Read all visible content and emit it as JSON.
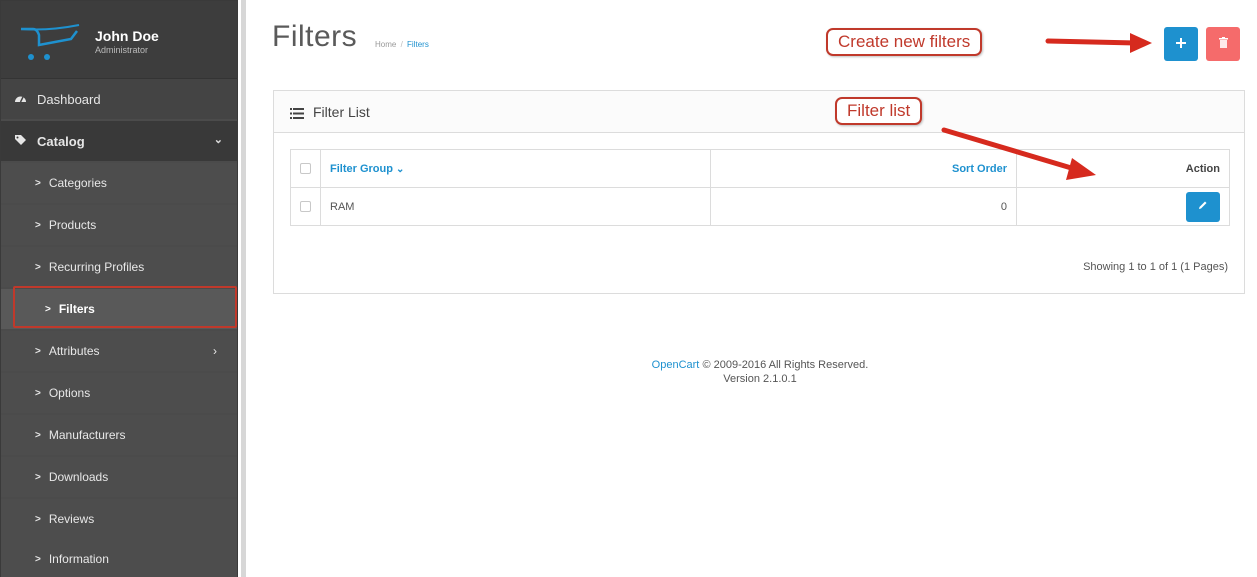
{
  "user": {
    "name": "John Doe",
    "role": "Administrator"
  },
  "sidebar": {
    "dashboard_label": "Dashboard",
    "catalog_label": "Catalog",
    "items": [
      {
        "label": "Categories"
      },
      {
        "label": "Products"
      },
      {
        "label": "Recurring Profiles"
      },
      {
        "label": "Filters",
        "active": true
      },
      {
        "label": "Attributes",
        "has_submenu": true
      },
      {
        "label": "Options"
      },
      {
        "label": "Manufacturers"
      },
      {
        "label": "Downloads"
      },
      {
        "label": "Reviews"
      },
      {
        "label": "Information"
      }
    ]
  },
  "header": {
    "title": "Filters",
    "breadcrumb": [
      {
        "label": "Home"
      },
      {
        "label": "Filters"
      }
    ],
    "breadcrumb_separator": "/"
  },
  "toolbar": {
    "add_icon": "plus-icon",
    "delete_icon": "trash-icon"
  },
  "panel": {
    "title": "Filter List",
    "icon": "list-icon"
  },
  "table": {
    "headers": {
      "filter_group": "Filter Group",
      "sort_order": "Sort Order",
      "action": "Action"
    },
    "rows": [
      {
        "filter_group": "RAM",
        "sort_order": "0"
      }
    ]
  },
  "pagination_text": "Showing 1 to 1 of 1 (1 Pages)",
  "footer": {
    "link": "OpenCart",
    "copyright": "© 2009-2016 All Rights Reserved.",
    "version": "Version 2.1.0.1"
  },
  "annotations": {
    "create": "Create new filters",
    "list": "Filter list"
  },
  "colors": {
    "primary": "#1e91cf",
    "danger": "#f56b6b",
    "annotation": "#c0392b",
    "sidebar": "#4b4b4b"
  }
}
